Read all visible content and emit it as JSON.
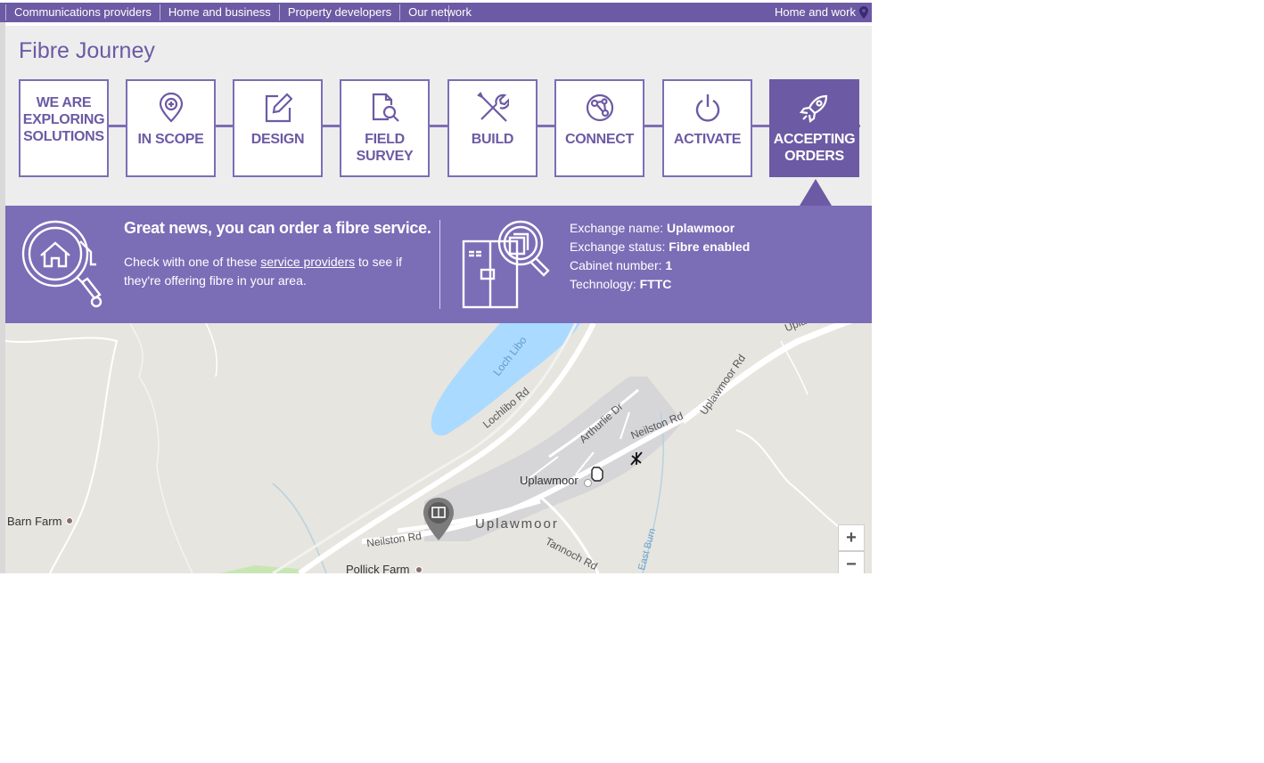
{
  "topnav": {
    "items": [
      "Communications providers",
      "Home and business",
      "Property developers",
      "Our network"
    ],
    "right_label": "Home and work"
  },
  "journey": {
    "title": "Fibre Journey",
    "steps": [
      {
        "label": "We are exploring solutions",
        "icon": "none"
      },
      {
        "label": "In scope",
        "icon": "map-pin-plus-icon"
      },
      {
        "label": "Design",
        "icon": "pencil-square-icon"
      },
      {
        "label": "Field survey",
        "icon": "document-search-icon"
      },
      {
        "label": "Build",
        "icon": "wrench-screwdriver-icon"
      },
      {
        "label": "Connect",
        "icon": "globe-network-icon"
      },
      {
        "label": "Activate",
        "icon": "power-icon"
      },
      {
        "label": "Accepting orders",
        "icon": "rocket-icon",
        "active": true
      }
    ]
  },
  "info": {
    "headline": "Great news, you can order a fibre service.",
    "body_prefix": "Check with one of these",
    "body_link": "service providers",
    "body_suffix": "to see if they're offering fibre in your area.",
    "details": {
      "exchange_name_label": "Exchange name:",
      "exchange_name": "Uplawmoor",
      "exchange_status_label": "Exchange status:",
      "exchange_status": "Fibre enabled",
      "cabinet_label": "Cabinet number:",
      "cabinet": "1",
      "technology_label": "Technology:",
      "technology": "FTTC"
    }
  },
  "map": {
    "labels": {
      "loch": "Loch Libo",
      "lochlibo_rd": "Lochlibo Rd",
      "arthurlie_dr": "Arthurlie Dr",
      "neilston_rd_east": "Neilston Rd",
      "uplawmoor_rd": "Uplawmoor Rd",
      "uplawmoor_rd_ne": "Uplawmoor Rd",
      "uplawmoor_small": "Uplawmoor",
      "uplawmoor_big": "Uplawmoor",
      "barn_farm": "Barn Farm",
      "neilston_rd_west": "Neilston Rd",
      "tannoch_rd": "Tannoch Rd",
      "east_burn": "East Burn",
      "pollick_farm": "Pollick Farm"
    },
    "zoom_in": "+",
    "zoom_out": "−"
  },
  "colors": {
    "brand_purple": "#6c5aa4",
    "band_purple": "#7b6db6",
    "panel_grey": "#ededed",
    "map_land": "#e7e5df",
    "water": "#aadaff"
  }
}
